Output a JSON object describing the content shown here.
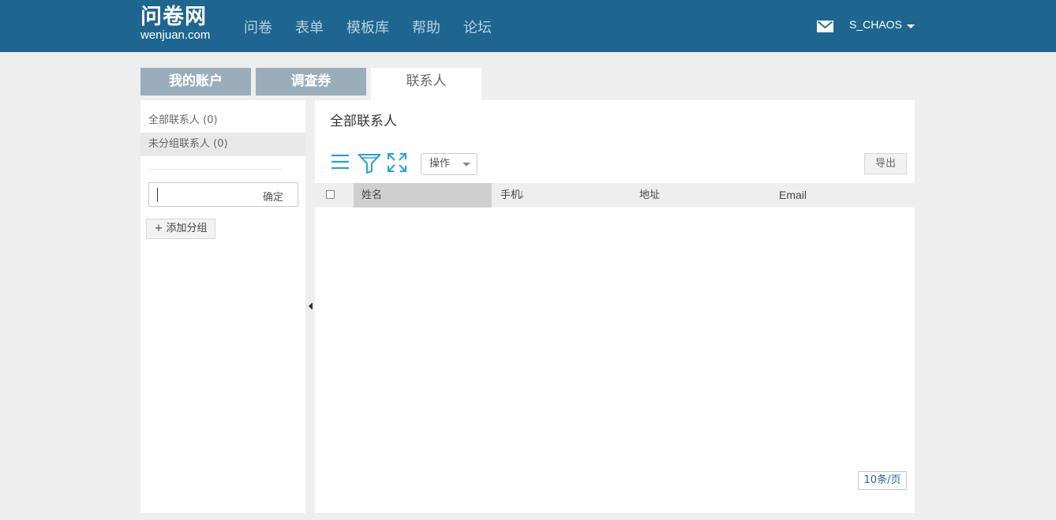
{
  "brand": {
    "name_cn": "问卷网",
    "domain": "wenjuan.com"
  },
  "nav": {
    "items": [
      "问卷",
      "表单",
      "模板库",
      "帮助",
      "论坛"
    ]
  },
  "user": {
    "name": "S_CHAOS",
    "icons": [
      "mail-icon",
      "caret-down-icon"
    ]
  },
  "tabs": [
    {
      "label": "我的账户",
      "active": false
    },
    {
      "label": "调查券",
      "active": false
    },
    {
      "label": "联系人",
      "active": true
    }
  ],
  "sidebar": {
    "groups": [
      {
        "label": "全部联系人 (0)",
        "selected": false
      },
      {
        "label": "未分组联系人 (0)",
        "selected": true
      }
    ],
    "group_input": {
      "value": "",
      "placeholder": ""
    },
    "confirm_label": "确定",
    "add_group_label": "+ 添加分组"
  },
  "main": {
    "title": "全部联系人",
    "toolbar": {
      "icons": [
        "list-icon",
        "filter-icon",
        "expand-icon"
      ],
      "ops_select": "操作",
      "export_label": "导出"
    },
    "table": {
      "columns": [
        "姓名",
        "手机",
        "地址",
        "Email"
      ],
      "sorted_column": "姓名",
      "sort_direction": "descending",
      "rows": []
    },
    "page_size": "10条/页"
  },
  "colors": {
    "header_bg": "#1e6690",
    "inactive_tab": "#9aadbb",
    "icon_blue": "#2a9fd6",
    "page_bg": "#eeeeee"
  }
}
